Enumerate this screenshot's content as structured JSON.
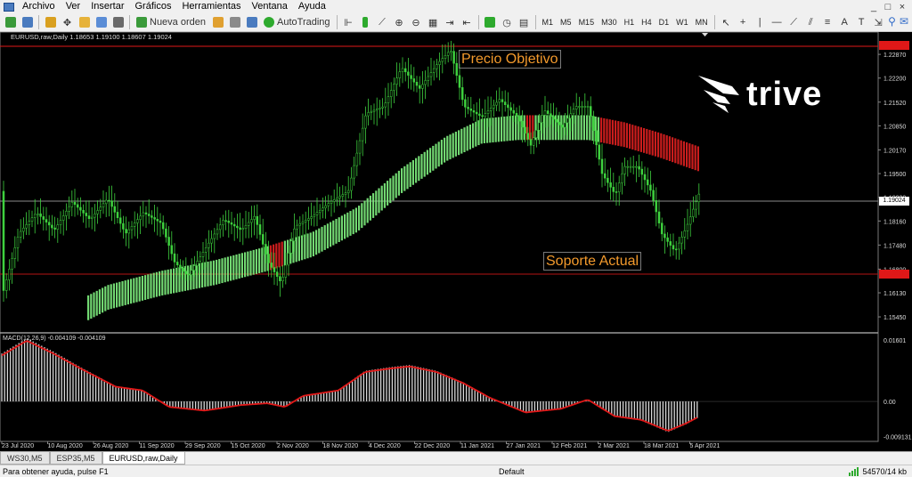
{
  "menu": {
    "items": [
      "Archivo",
      "Ver",
      "Insertar",
      "Gráficos",
      "Herramientas",
      "Ventana",
      "Ayuda"
    ],
    "window_controls": [
      "_",
      "□",
      "×"
    ]
  },
  "toolbar": {
    "new_order": "Nueva orden",
    "auto_trading": "AutoTrading",
    "timeframes": [
      "M1",
      "M5",
      "M15",
      "M30",
      "H1",
      "H4",
      "D1",
      "W1",
      "MN"
    ]
  },
  "chart": {
    "symbol_info": "EURUSD,raw,Daily  1.18653 1.19100 1.18607 1.19024",
    "macd_info": "MACD(12,26,9) -0.004109 -0.004109",
    "annotations": {
      "target": "Precio Objetivo",
      "support": "Soporte Actual"
    },
    "logo_text": "trive",
    "price_axis": [
      "1.22870",
      "1.22200",
      "1.21520",
      "1.20850",
      "1.20170",
      "1.19500",
      "1.18830",
      "1.18160",
      "1.17480",
      "1.16800",
      "1.16130",
      "1.15450"
    ],
    "current_price": "1.19024",
    "top_line_price": "1.22870",
    "support_price": "1.16800",
    "macd_axis": [
      "0.01601",
      "0.00",
      "-0.009131"
    ],
    "date_axis": [
      "23 Jul 2020",
      "10 Aug 2020",
      "26 Aug 2020",
      "11 Sep 2020",
      "29 Sep 2020",
      "15 Oct 2020",
      "2 Nov 2020",
      "18 Nov 2020",
      "4 Dec 2020",
      "22 Dec 2020",
      "11 Jan 2021",
      "27 Jan 2021",
      "12 Feb 2021",
      "2 Mar 2021",
      "18 Mar 2021",
      "5 Apr 2021"
    ],
    "colors": {
      "bull": "#3ed13e",
      "ma_up": "#7ef07e",
      "ma_down": "#e02020",
      "macd_line": "#e01818",
      "hist": "#d8d8d8"
    }
  },
  "tabs": [
    "WS30,M5",
    "ESP35,M5",
    "EURUSD,raw,Daily"
  ],
  "status": {
    "help": "Para obtener ayuda, pulse F1",
    "profile": "Default",
    "traffic": "54570/14 kb"
  }
}
